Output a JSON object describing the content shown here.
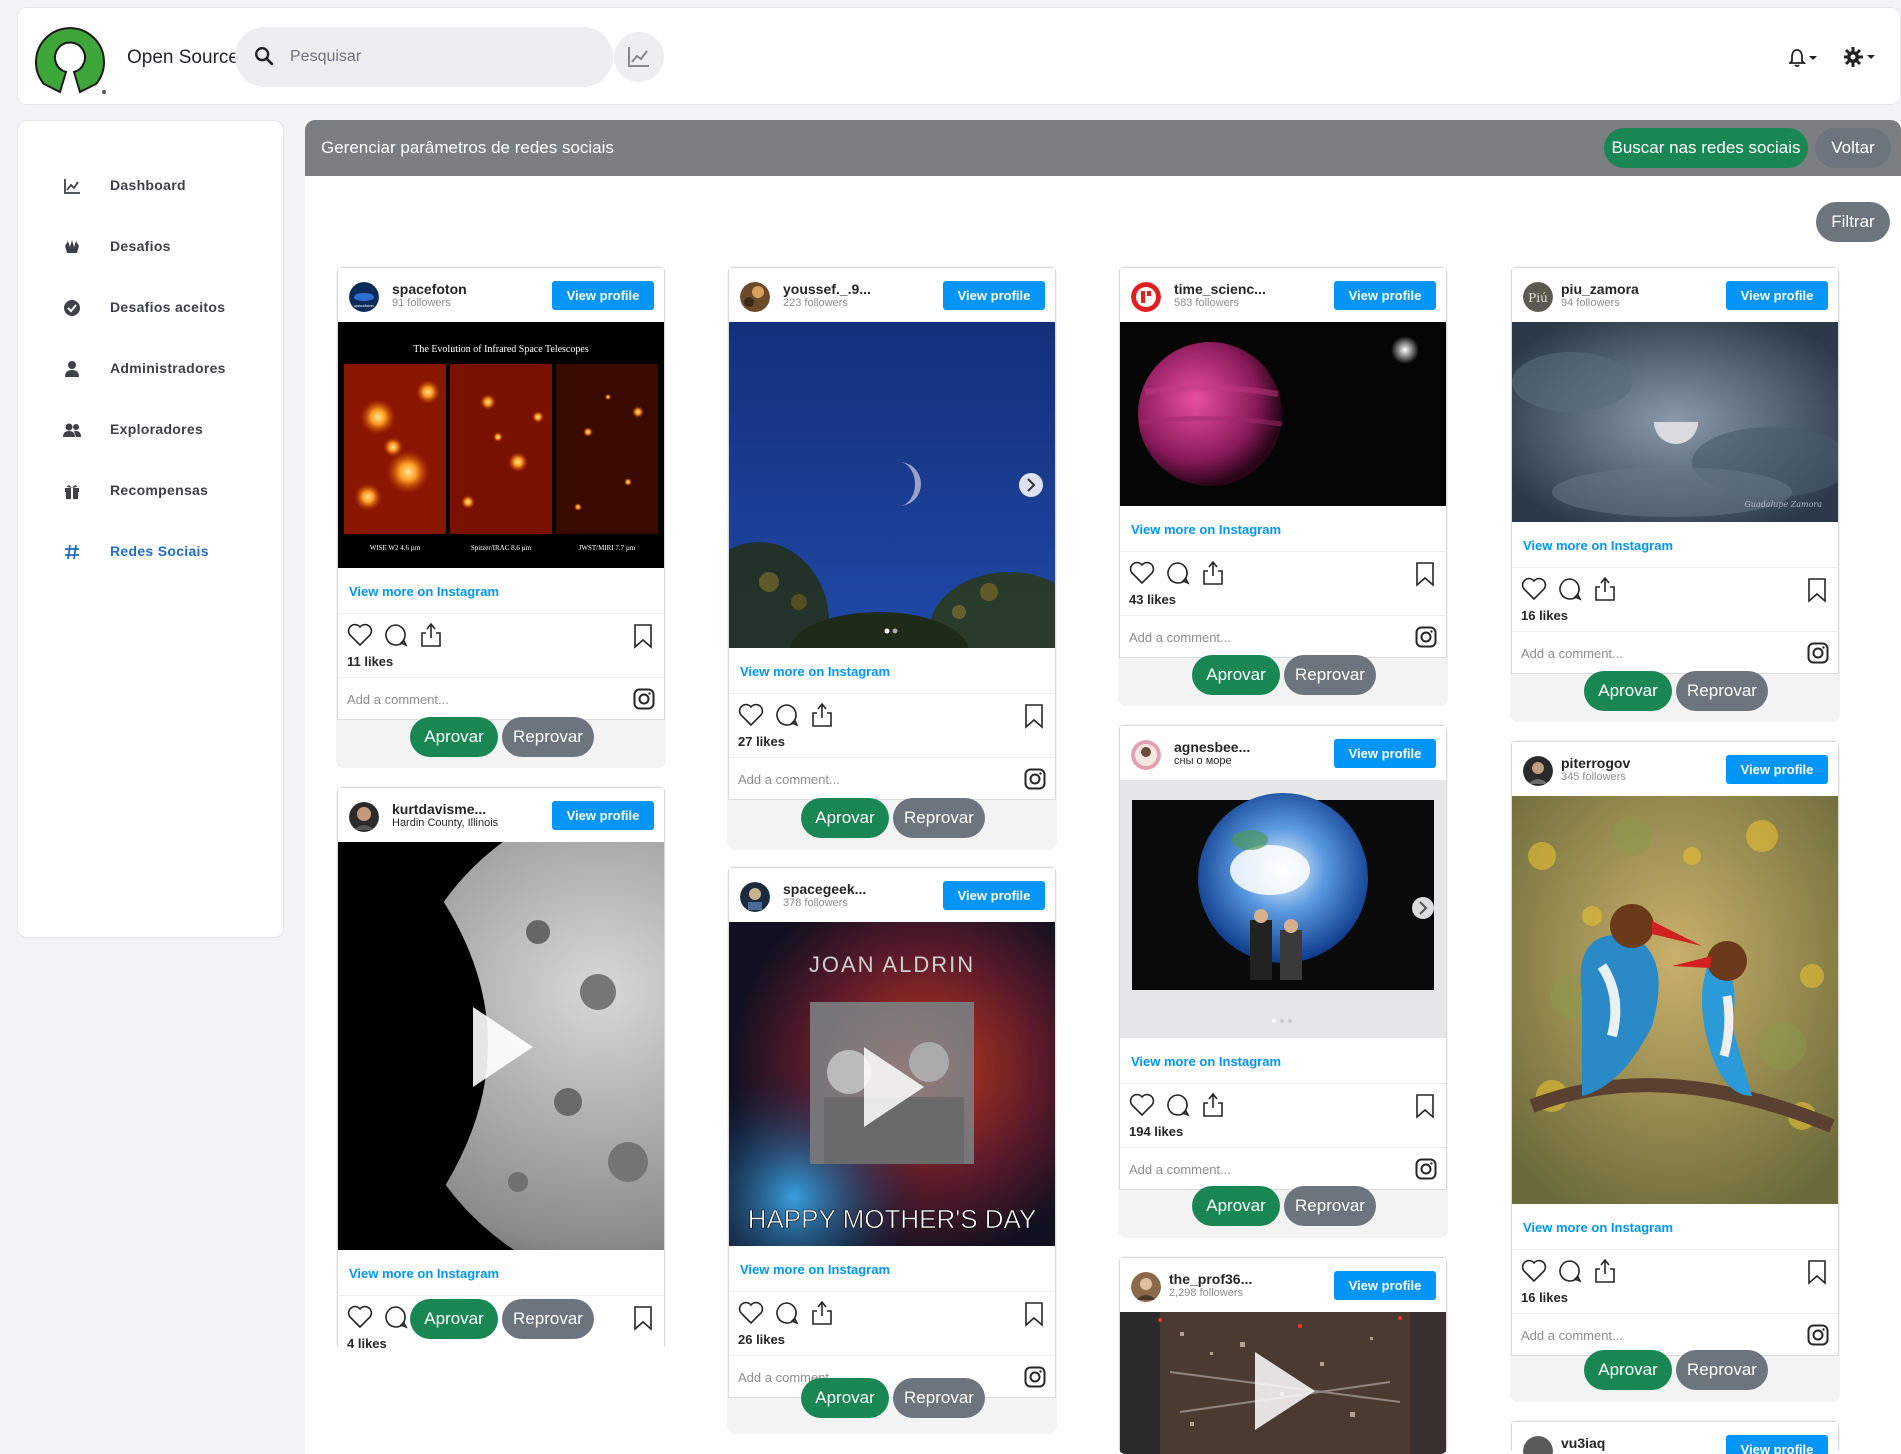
{
  "app": {
    "brand": "Open Source",
    "search_placeholder": "Pesquisar"
  },
  "sidebar": {
    "items": [
      {
        "label": "Dashboard",
        "icon": "chart-line-icon"
      },
      {
        "label": "Desafios",
        "icon": "hands-icon"
      },
      {
        "label": "Desafios aceitos",
        "icon": "check-circle-icon"
      },
      {
        "label": "Administradores",
        "icon": "user-icon"
      },
      {
        "label": "Exploradores",
        "icon": "users-icon"
      },
      {
        "label": "Recompensas",
        "icon": "gift-icon"
      },
      {
        "label": "Redes Sociais",
        "icon": "hashtag-icon",
        "active": true
      }
    ]
  },
  "main": {
    "title": "Gerenciar parâmetros de redes sociais",
    "search_button": "Buscar nas redes sociais",
    "back_button": "Voltar",
    "filter_button": "Filtrar"
  },
  "common": {
    "view_profile": "View profile",
    "view_more": "View more on Instagram",
    "add_comment": "Add a comment...",
    "approve": "Aprovar",
    "reject": "Reprovar"
  },
  "posts": [
    {
      "user": "spacefoton",
      "sub": "91 followers",
      "likes": "11 likes",
      "caption_title": "The Evolution of Infrared Space Telescopes",
      "panel_labels": [
        "WISE W2 4.6 µm",
        "Spitzer/IRAC 8.6 µm",
        "JWST/MIRI 7.7 µm"
      ]
    },
    {
      "user": "kurtdavisme...",
      "sub": "Hardin County, Illinois",
      "likes": "4 likes"
    },
    {
      "user": "youssef._.9...",
      "sub": "223 followers",
      "likes": "27 likes"
    },
    {
      "user": "spacegeek...",
      "sub": "378 followers",
      "likes": "26 likes",
      "image_text_top": "JOAN ALDRIN",
      "image_text_bottom": "HAPPY MOTHER'S DAY"
    },
    {
      "user": "time_scienc...",
      "sub": "583 followers",
      "likes": "43 likes"
    },
    {
      "user": "agnesbee...",
      "sub": "сны о море",
      "likes": "194 likes"
    },
    {
      "user": "the_prof36...",
      "sub": "2,298 followers"
    },
    {
      "user": "piu_zamora",
      "sub": "94 followers",
      "likes": "16 likes",
      "avatar_text": "Piú",
      "signature": "Guadalupe Zamora"
    },
    {
      "user": "piterrogov",
      "sub": "345 followers",
      "likes": "16 likes"
    },
    {
      "user": "vu3iaq"
    }
  ]
}
